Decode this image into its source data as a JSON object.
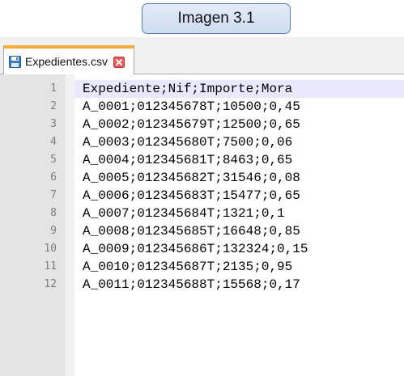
{
  "caption": "Imagen 3.1",
  "tab": {
    "label": "Expedientes.csv",
    "icon": "floppy-disk-icon",
    "close_icon": "close-icon"
  },
  "editor": {
    "current_line": 1,
    "lines": [
      {
        "number": "1",
        "text": "Expediente;Nif;Importe;Mora"
      },
      {
        "number": "2",
        "text": "A_0001;012345678T;10500;0,45"
      },
      {
        "number": "3",
        "text": "A_0002;012345679T;12500;0,65"
      },
      {
        "number": "4",
        "text": "A_0003;012345680T;7500;0,06"
      },
      {
        "number": "5",
        "text": "A_0004;012345681T;8463;0,65"
      },
      {
        "number": "6",
        "text": "A_0005;012345682T;31546;0,08"
      },
      {
        "number": "7",
        "text": "A_0006;012345683T;15477;0,65"
      },
      {
        "number": "8",
        "text": "A_0007;012345684T;1321;0,1"
      },
      {
        "number": "9",
        "text": "A_0008;012345685T;16648;0,85"
      },
      {
        "number": "10",
        "text": "A_0009;012345686T;132324;0,15"
      },
      {
        "number": "11",
        "text": "A_0010;012345687T;2135;0,95"
      },
      {
        "number": "12",
        "text": "A_0011;012345688T;15568;0,17"
      }
    ]
  },
  "colors": {
    "tab_accent": "#f7a93b",
    "current_line_highlight": "#e8e8ff",
    "gutter": "#e4e4e4",
    "caption_border": "#5a7fb4"
  }
}
